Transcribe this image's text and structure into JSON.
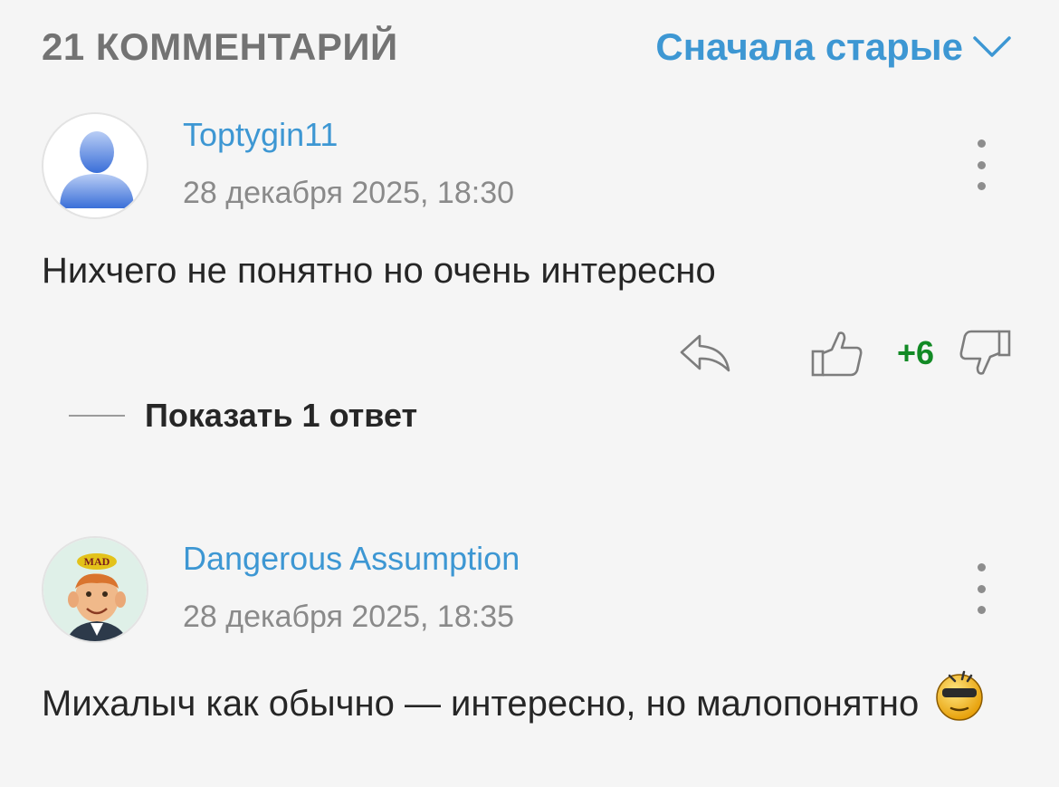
{
  "header": {
    "count_title": "21 КОММЕНТАРИЙ",
    "sort_label": "Сначала старые"
  },
  "comments": [
    {
      "author": "Toptygin11",
      "date": "28 декабря 2025, 18:30",
      "text": "Нихчего не понятно но очень интересно",
      "rating": "+6",
      "show_replies": "Показать 1 ответ",
      "avatar_icon": "default-user-avatar"
    },
    {
      "author": "Dangerous Assumption",
      "date": "28 декабря 2025, 18:35",
      "text": "Михалыч как обычно — интересно, но малопонятно",
      "avatar_icon": "mad-magazine-avatar",
      "emoji_icon": "cool-smiley-emoji"
    }
  ],
  "colors": {
    "accent": "#3d97d3",
    "positive": "#128a25",
    "muted": "#8a8a8a",
    "background": "#f5f5f5"
  }
}
